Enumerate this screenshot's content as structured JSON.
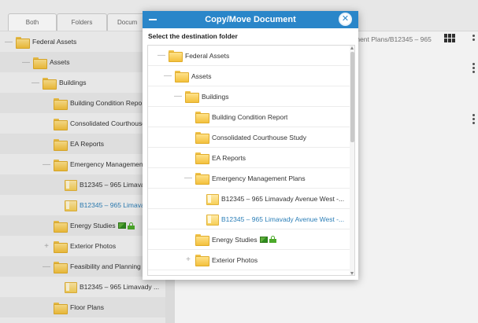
{
  "tabs": [
    {
      "label": "Both"
    },
    {
      "label": "Folders"
    },
    {
      "label": "Docum"
    }
  ],
  "tree": [
    {
      "label": "Federal Assets",
      "toggle": "—",
      "type": "folder"
    },
    {
      "label": "Assets",
      "toggle": "—",
      "type": "folder"
    },
    {
      "label": "Buildings",
      "toggle": "—",
      "type": "folder"
    },
    {
      "label": "Building Condition Repo",
      "toggle": "",
      "type": "folder"
    },
    {
      "label": "Consolidated Courthouse",
      "toggle": "",
      "type": "folder"
    },
    {
      "label": "EA Reports",
      "toggle": "",
      "type": "folder"
    },
    {
      "label": "Emergency Management",
      "toggle": "—",
      "type": "folder"
    },
    {
      "label": "B12345 – 965 Limava",
      "toggle": "",
      "type": "doc"
    },
    {
      "label": "B12345 – 965 Limava",
      "toggle": "",
      "type": "doc"
    },
    {
      "label": "Energy Studies",
      "toggle": "",
      "type": "folder"
    },
    {
      "label": "Exterior Photos",
      "toggle": "+",
      "type": "folder"
    },
    {
      "label": "Feasibility and Planning",
      "toggle": "—",
      "type": "folder"
    },
    {
      "label": "B12345 – 965 Limavady ...",
      "toggle": "",
      "type": "doc"
    },
    {
      "label": "Floor Plans",
      "toggle": "",
      "type": "folder"
    }
  ],
  "header_path": "ment Plans/B12345 – 965",
  "modal": {
    "title": "Copy/Move Document",
    "subtitle": "Select the destination folder",
    "close_glyph": "✕",
    "rows": [
      {
        "label": "Federal Assets",
        "toggle": "—",
        "type": "folder"
      },
      {
        "label": "Assets",
        "toggle": "—",
        "type": "folder"
      },
      {
        "label": "Buildings",
        "toggle": "—",
        "type": "folder"
      },
      {
        "label": "Building Condition Report",
        "toggle": "",
        "type": "folder"
      },
      {
        "label": "Consolidated Courthouse Study",
        "toggle": "",
        "type": "folder"
      },
      {
        "label": "EA Reports",
        "toggle": "",
        "type": "folder"
      },
      {
        "label": "Emergency Management Plans",
        "toggle": "—",
        "type": "folder"
      },
      {
        "label": "B12345 – 965 Limavady Avenue West -...",
        "toggle": "",
        "type": "doc"
      },
      {
        "label": "B12345 – 965 Limavady Avenue West -...",
        "toggle": "",
        "type": "doc"
      },
      {
        "label": "Energy Studies",
        "toggle": "",
        "type": "folder"
      },
      {
        "label": "Exterior Photos",
        "toggle": "+",
        "type": "folder"
      }
    ]
  },
  "colors": {
    "accent": "#2a86c9",
    "link_text": "#2c7fb8",
    "folder": "#f3c03c",
    "badge_green": "#4caa2a"
  },
  "icons": {
    "grid": "grid-view-icon",
    "more": "more-options-icon",
    "folder": "folder-icon",
    "document": "document-icon",
    "picture": "picture-icon",
    "lock": "lock-icon"
  }
}
